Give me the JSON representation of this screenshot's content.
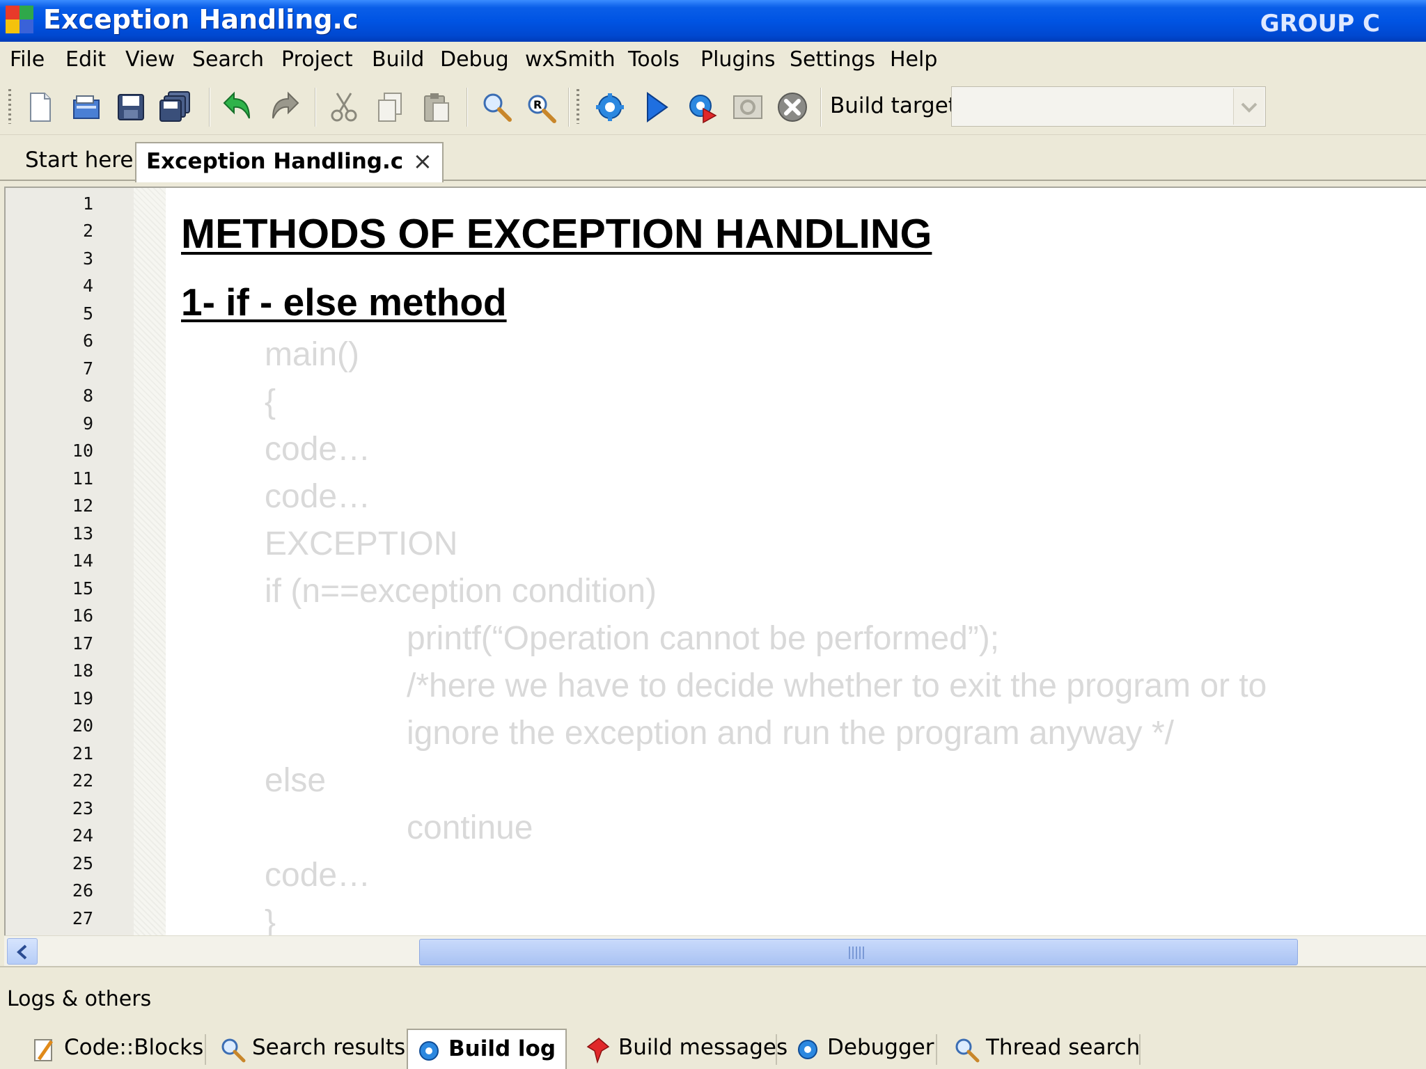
{
  "window": {
    "title": "Exception Handling.c",
    "group_label": "GROUP C"
  },
  "menu": [
    "File",
    "Edit",
    "View",
    "Search",
    "Project",
    "Build",
    "Debug",
    "wxSmith",
    "Tools",
    "Plugins",
    "Settings",
    "Help"
  ],
  "toolbar": {
    "icons": [
      "new-file-icon",
      "open-file-icon",
      "save-icon",
      "save-all-icon",
      "undo-icon",
      "redo-icon",
      "cut-icon",
      "copy-icon",
      "paste-icon",
      "find-icon",
      "replace-icon",
      "build-icon",
      "run-icon",
      "build-and-run-icon",
      "rebuild-icon",
      "abort-icon"
    ],
    "build_target_label": "Build target:",
    "build_target_value": ""
  },
  "tabs": [
    {
      "label": "Start here",
      "active": false
    },
    {
      "label": "Exception Handling.c",
      "active": true,
      "close": "×"
    }
  ],
  "editor": {
    "line_numbers": [
      "1",
      "2",
      "3",
      "4",
      "5",
      "6",
      "7",
      "8",
      "9",
      "10",
      "11",
      "12",
      "13",
      "14",
      "15",
      "16",
      "17",
      "18",
      "19",
      "20",
      "21",
      "22",
      "23",
      "24",
      "25",
      "26",
      "27"
    ],
    "heading": "METHODS OF EXCEPTION HANDLING",
    "subheading": "1- if - else method",
    "code_lines": [
      {
        "indent": 1,
        "text": "main()"
      },
      {
        "indent": 1,
        "text": "{"
      },
      {
        "indent": 1,
        "text": "code…"
      },
      {
        "indent": 1,
        "text": "code…"
      },
      {
        "indent": 1,
        "text": "EXCEPTION"
      },
      {
        "indent": 1,
        "text": "if (n==exception condition)"
      },
      {
        "indent": 2,
        "text": "printf(“Operation cannot be performed”);"
      },
      {
        "indent": 2,
        "text": "/*here we have to decide whether to exit the program or to"
      },
      {
        "indent": 2,
        "text": "ignore the exception and run the program anyway */"
      },
      {
        "indent": 1,
        "text": "else"
      },
      {
        "indent": 2,
        "text": "continue"
      },
      {
        "indent": 1,
        "text": "code…"
      },
      {
        "indent": 1,
        "text": "}"
      }
    ]
  },
  "logs_panel": {
    "title": "Logs & others",
    "tabs": [
      {
        "label": "Code::Blocks",
        "icon": "codeblocks-icon",
        "active": false
      },
      {
        "label": "Search results",
        "icon": "search-results-icon",
        "active": false
      },
      {
        "label": "Build log",
        "icon": "build-log-icon",
        "active": true
      },
      {
        "label": "Build messages",
        "icon": "build-messages-icon",
        "active": false
      },
      {
        "label": "Debugger",
        "icon": "debugger-icon",
        "active": false
      },
      {
        "label": "Thread search",
        "icon": "thread-search-icon",
        "active": false
      }
    ]
  },
  "colors": {
    "titlebar": "#0054e3",
    "chrome": "#ece9d8",
    "code_text": "#d9d9d9",
    "heading_text": "#000000"
  }
}
